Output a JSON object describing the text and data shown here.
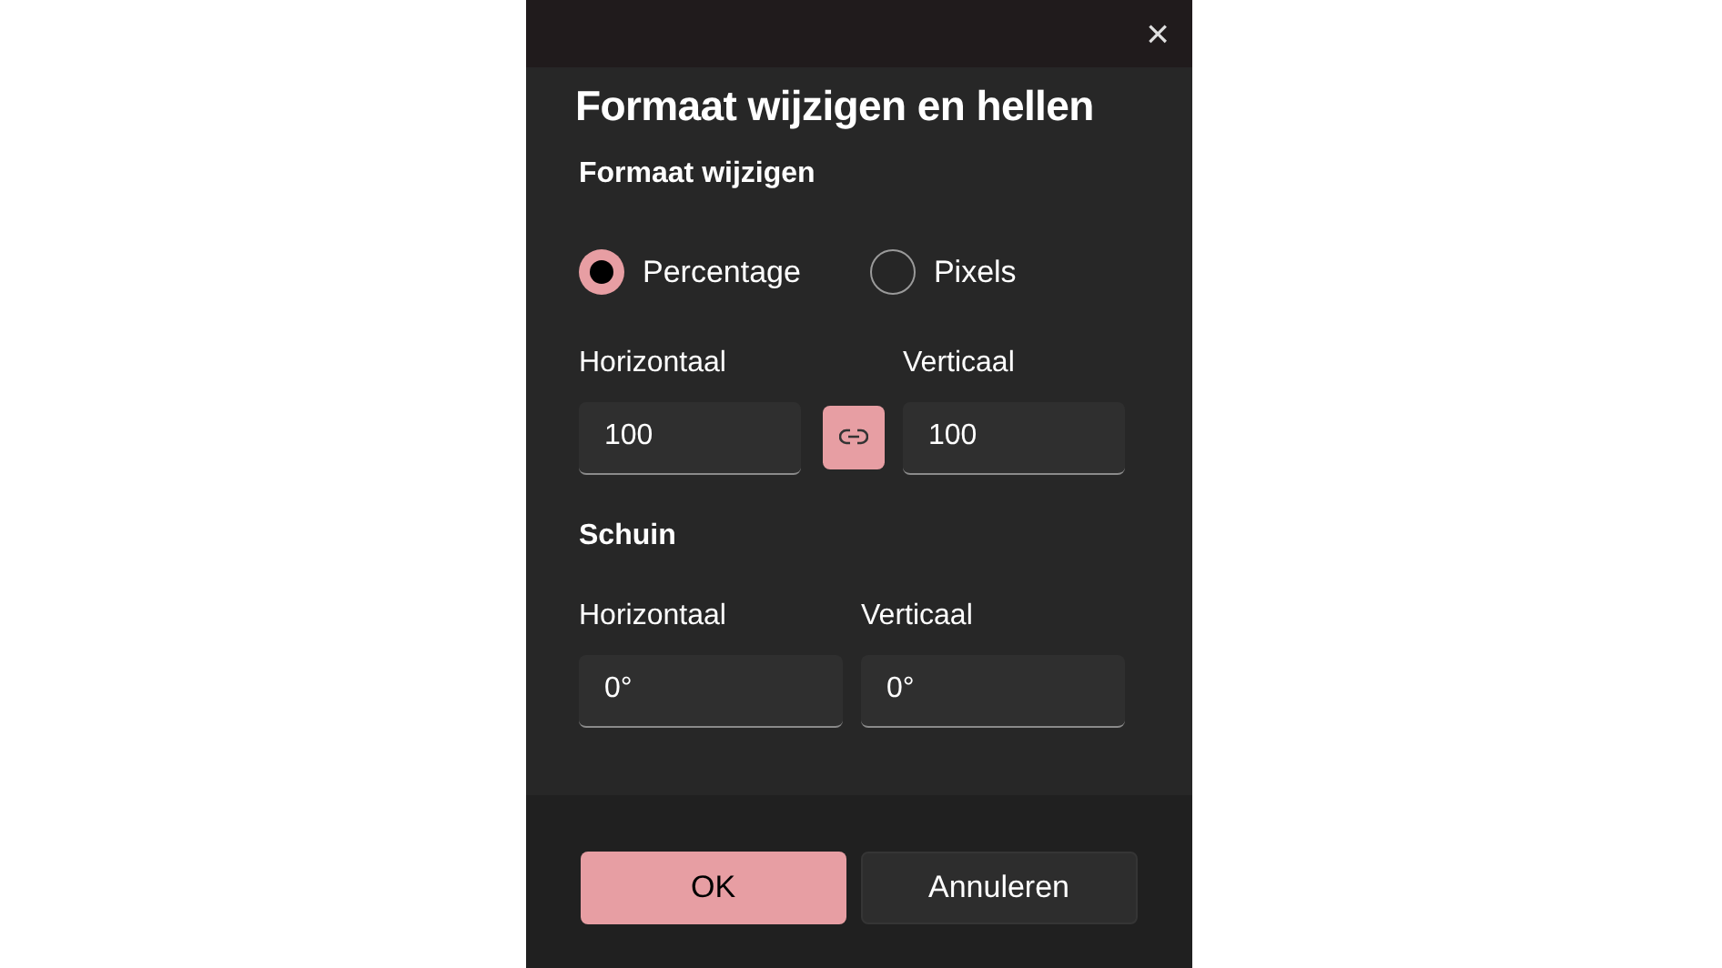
{
  "dialog": {
    "title": "Formaat wijzigen en hellen",
    "close_label": "×"
  },
  "resize": {
    "heading": "Formaat wijzigen",
    "modes": [
      {
        "label": "Percentage",
        "selected": true
      },
      {
        "label": "Pixels",
        "selected": false
      }
    ],
    "horizontal": {
      "label": "Horizontaal",
      "value": "100"
    },
    "vertical": {
      "label": "Verticaal",
      "value": "100"
    },
    "lock_aspect": {
      "on": true
    }
  },
  "skew": {
    "heading": "Schuin",
    "horizontal": {
      "label": "Horizontaal",
      "value": "0°"
    },
    "vertical": {
      "label": "Verticaal",
      "value": "0°"
    }
  },
  "buttons": [
    {
      "label": "OK",
      "kind": "primary"
    },
    {
      "label": "Annuleren",
      "kind": "secondary"
    }
  ]
}
